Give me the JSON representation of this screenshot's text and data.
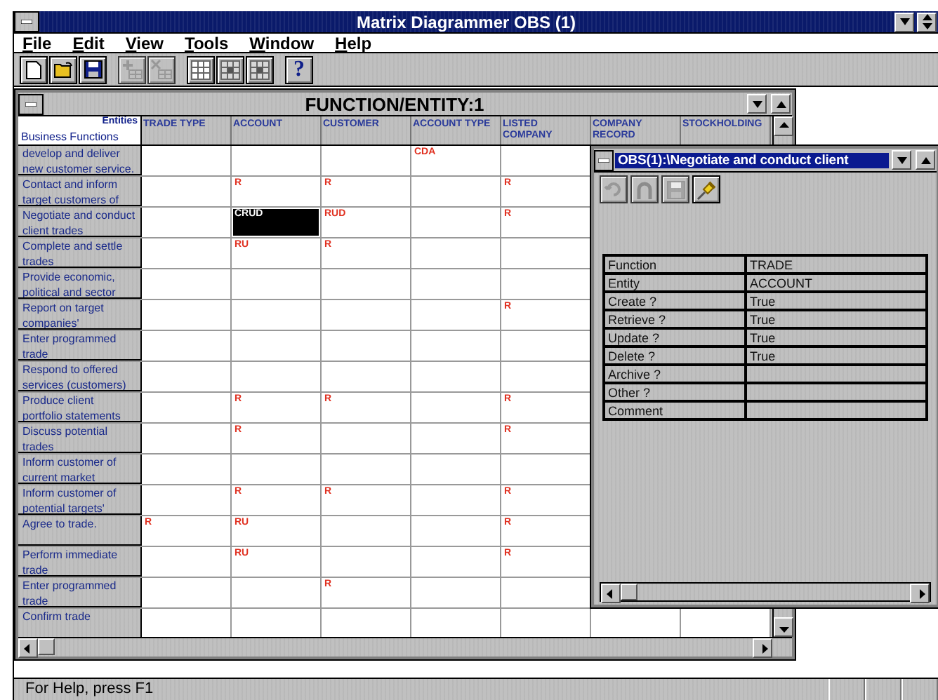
{
  "app": {
    "title": "Matrix Diagrammer OBS (1)"
  },
  "menu": [
    {
      "label": "File"
    },
    {
      "label": "Edit"
    },
    {
      "label": "View"
    },
    {
      "label": "Tools"
    },
    {
      "label": "Window"
    },
    {
      "label": "Help"
    }
  ],
  "toolbar": [
    {
      "kind": "new",
      "disabled": false
    },
    {
      "kind": "open",
      "disabled": false
    },
    {
      "kind": "save",
      "disabled": false
    },
    {
      "kind": "sep"
    },
    {
      "kind": "add",
      "disabled": true
    },
    {
      "kind": "remove",
      "disabled": true
    },
    {
      "kind": "sep"
    },
    {
      "kind": "grid",
      "disabled": false
    },
    {
      "kind": "grid2",
      "disabled": false
    },
    {
      "kind": "grid3",
      "disabled": false
    },
    {
      "kind": "sep"
    },
    {
      "kind": "help",
      "label": "?",
      "disabled": false
    }
  ],
  "grid": {
    "title": "FUNCTION/ENTITY:1",
    "corner_top": "Entities",
    "corner_bottom": "Business Functions",
    "columns": [
      "TRADE TYPE",
      "ACCOUNT",
      "CUSTOMER",
      "ACCOUNT TYPE",
      "LISTED COMPANY",
      "COMPANY RECORD",
      "STOCKHOLDING"
    ],
    "rows": [
      {
        "function": "develop and deliver new customer service.",
        "cells": [
          null,
          null,
          null,
          {
            "value": "CDA",
            "selected": false
          },
          null,
          null,
          null
        ]
      },
      {
        "function": "Contact and inform target customers of",
        "cells": [
          null,
          {
            "value": "R",
            "selected": false
          },
          {
            "value": "R",
            "selected": false
          },
          null,
          {
            "value": "R",
            "selected": false
          },
          null,
          null
        ]
      },
      {
        "function": "Negotiate and conduct client trades",
        "cells": [
          null,
          {
            "value": "CRUD",
            "selected": true
          },
          {
            "value": "RUD",
            "selected": false
          },
          null,
          {
            "value": "R",
            "selected": false
          },
          null,
          null
        ]
      },
      {
        "function": "Complete and settle trades",
        "cells": [
          null,
          {
            "value": "RU",
            "selected": false
          },
          {
            "value": "R",
            "selected": false
          },
          null,
          null,
          null,
          null
        ]
      },
      {
        "function": "Provide economic, political and sector",
        "cells": [
          null,
          null,
          null,
          null,
          null,
          null,
          null
        ]
      },
      {
        "function": "Report on target companies'",
        "cells": [
          null,
          null,
          null,
          null,
          {
            "value": "R",
            "selected": false
          },
          null,
          null
        ]
      },
      {
        "function": "Enter programmed trade",
        "cells": [
          null,
          null,
          null,
          null,
          null,
          null,
          null
        ]
      },
      {
        "function": "Respond to offered services (customers)",
        "cells": [
          null,
          null,
          null,
          null,
          null,
          null,
          null
        ]
      },
      {
        "function": "Produce client portfolio statements",
        "cells": [
          null,
          {
            "value": "R",
            "selected": false
          },
          {
            "value": "R",
            "selected": false
          },
          null,
          {
            "value": "R",
            "selected": false
          },
          null,
          null
        ]
      },
      {
        "function": "Discuss potential trades",
        "cells": [
          null,
          {
            "value": "R",
            "selected": false
          },
          null,
          null,
          {
            "value": "R",
            "selected": false
          },
          null,
          null
        ]
      },
      {
        "function": "Inform customer of current market",
        "cells": [
          null,
          null,
          null,
          null,
          null,
          null,
          null
        ]
      },
      {
        "function": "Inform customer of potential targets'",
        "cells": [
          null,
          {
            "value": "R",
            "selected": false
          },
          {
            "value": "R",
            "selected": false
          },
          null,
          {
            "value": "R",
            "selected": false
          },
          null,
          null
        ]
      },
      {
        "function": "Agree to trade.",
        "cells": [
          {
            "value": "R",
            "selected": false
          },
          {
            "value": "RU",
            "selected": false
          },
          null,
          null,
          {
            "value": "R",
            "selected": false
          },
          null,
          null
        ]
      },
      {
        "function": "Perform immediate trade",
        "cells": [
          null,
          {
            "value": "RU",
            "selected": false
          },
          null,
          null,
          {
            "value": "R",
            "selected": false
          },
          null,
          null
        ]
      },
      {
        "function": "Enter programmed trade",
        "cells": [
          null,
          null,
          {
            "value": "R",
            "selected": false
          },
          null,
          null,
          null,
          null
        ]
      },
      {
        "function": "Confirm trade",
        "cells": [
          null,
          null,
          null,
          null,
          null,
          null,
          null
        ]
      }
    ]
  },
  "detail": {
    "title": "OBS(1):\\Negotiate and conduct client",
    "tools": [
      {
        "kind": "refresh",
        "disabled": true
      },
      {
        "kind": "magnet",
        "disabled": true
      },
      {
        "kind": "save",
        "disabled": true
      },
      {
        "kind": "pin",
        "disabled": false
      }
    ],
    "properties": [
      {
        "name": "Function",
        "value": "TRADE"
      },
      {
        "name": "Entity",
        "value": "ACCOUNT"
      },
      {
        "name": "Create ?",
        "value": "True"
      },
      {
        "name": "Retrieve ?",
        "value": "True"
      },
      {
        "name": "Update ?",
        "value": "True"
      },
      {
        "name": "Delete ?",
        "value": "True"
      },
      {
        "name": "Archive ?"
      },
      {
        "name": "Other ?"
      },
      {
        "name": "Comment"
      }
    ]
  },
  "status_bar": {
    "text": "For Help, press F1"
  }
}
